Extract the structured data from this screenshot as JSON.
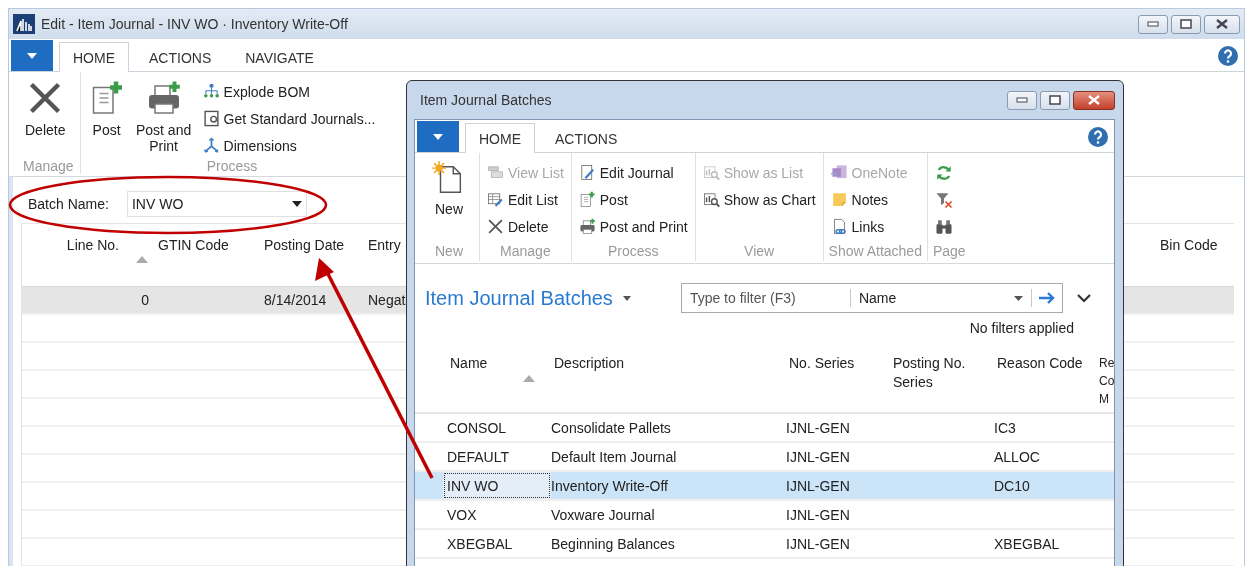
{
  "window": {
    "title": "Edit - Item Journal - INV WO · Inventory Write-Off"
  },
  "tabs": [
    {
      "label": "HOME",
      "selected": true
    },
    {
      "label": "ACTIONS",
      "selected": false
    },
    {
      "label": "NAVIGATE",
      "selected": false
    }
  ],
  "ribbon_groups": [
    {
      "label": "Manage",
      "buttons": [
        {
          "label": "Delete",
          "kind": "large"
        }
      ]
    },
    {
      "label": "Process",
      "buttons": [
        {
          "label": "Post",
          "kind": "large"
        },
        {
          "label": "Post and Print",
          "kind": "large"
        },
        {
          "label": "Explode BOM",
          "kind": "small"
        },
        {
          "label": "Get Standard Journals...",
          "kind": "small"
        },
        {
          "label": "Dimensions",
          "kind": "small"
        }
      ]
    }
  ],
  "batch_name": {
    "label": "Batch Name:",
    "value": "INV WO"
  },
  "journal_lines": {
    "columns": [
      "Line No.",
      "GTIN Code",
      "Posting Date",
      "Entry",
      "Bin Code"
    ],
    "rows": [
      {
        "line_no": "0",
        "posting_date": "8/14/2014",
        "entry": "Negat",
        "selected": true
      }
    ]
  },
  "dialog": {
    "title": "Item Journal Batches",
    "tabs": [
      {
        "label": "HOME",
        "selected": true
      },
      {
        "label": "ACTIONS",
        "selected": false
      }
    ],
    "ribbon_groups": [
      {
        "label": "New",
        "buttons": [
          {
            "label": "New",
            "kind": "large",
            "disabled": false
          }
        ]
      },
      {
        "label": "Manage",
        "buttons": [
          {
            "label": "View List",
            "kind": "small",
            "disabled": true
          },
          {
            "label": "Edit List",
            "kind": "small",
            "disabled": false
          },
          {
            "label": "Delete",
            "kind": "small",
            "disabled": false
          }
        ]
      },
      {
        "label": "Process",
        "buttons": [
          {
            "label": "Edit Journal",
            "kind": "small",
            "disabled": false
          },
          {
            "label": "Post",
            "kind": "small",
            "disabled": false
          },
          {
            "label": "Post and Print",
            "kind": "small",
            "disabled": false
          }
        ]
      },
      {
        "label": "View",
        "buttons": [
          {
            "label": "Show as List",
            "kind": "small",
            "disabled": true
          },
          {
            "label": "Show as Chart",
            "kind": "small",
            "disabled": false
          }
        ]
      },
      {
        "label": "Show Attached",
        "buttons": [
          {
            "label": "OneNote",
            "kind": "small",
            "disabled": true
          },
          {
            "label": "Notes",
            "kind": "small",
            "disabled": false
          },
          {
            "label": "Links",
            "kind": "small",
            "disabled": false
          }
        ]
      },
      {
        "label": "Page",
        "buttons": [
          {
            "kind": "icon",
            "disabled": false
          },
          {
            "kind": "icon",
            "disabled": false
          },
          {
            "kind": "icon",
            "disabled": false
          }
        ]
      }
    ],
    "page_title": "Item Journal Batches",
    "filter": {
      "placeholder": "Type to filter (F3)",
      "field": "Name"
    },
    "filter_status": "No filters applied",
    "table": {
      "columns": [
        "Name",
        "Description",
        "No. Series",
        "Posting No. Series",
        "Reason Code",
        "Re Co M"
      ],
      "rows": [
        {
          "name": "CONSOL",
          "description": "Consolidate Pallets",
          "no_series": "IJNL-GEN",
          "reason_code": "IC3",
          "selected": false
        },
        {
          "name": "DEFAULT",
          "description": "Default Item Journal",
          "no_series": "IJNL-GEN",
          "reason_code": "ALLOC",
          "selected": false
        },
        {
          "name": "INV WO",
          "description": "Inventory Write-Off",
          "no_series": "IJNL-GEN",
          "reason_code": "DC10",
          "selected": true
        },
        {
          "name": "VOX",
          "description": "Voxware Journal",
          "no_series": "IJNL-GEN",
          "selected": false
        },
        {
          "name": "XBEGBAL",
          "description": "Beginning Balances",
          "no_series": "IJNL-GEN",
          "reason_code": "XBEGBAL",
          "selected": false
        }
      ]
    }
  }
}
